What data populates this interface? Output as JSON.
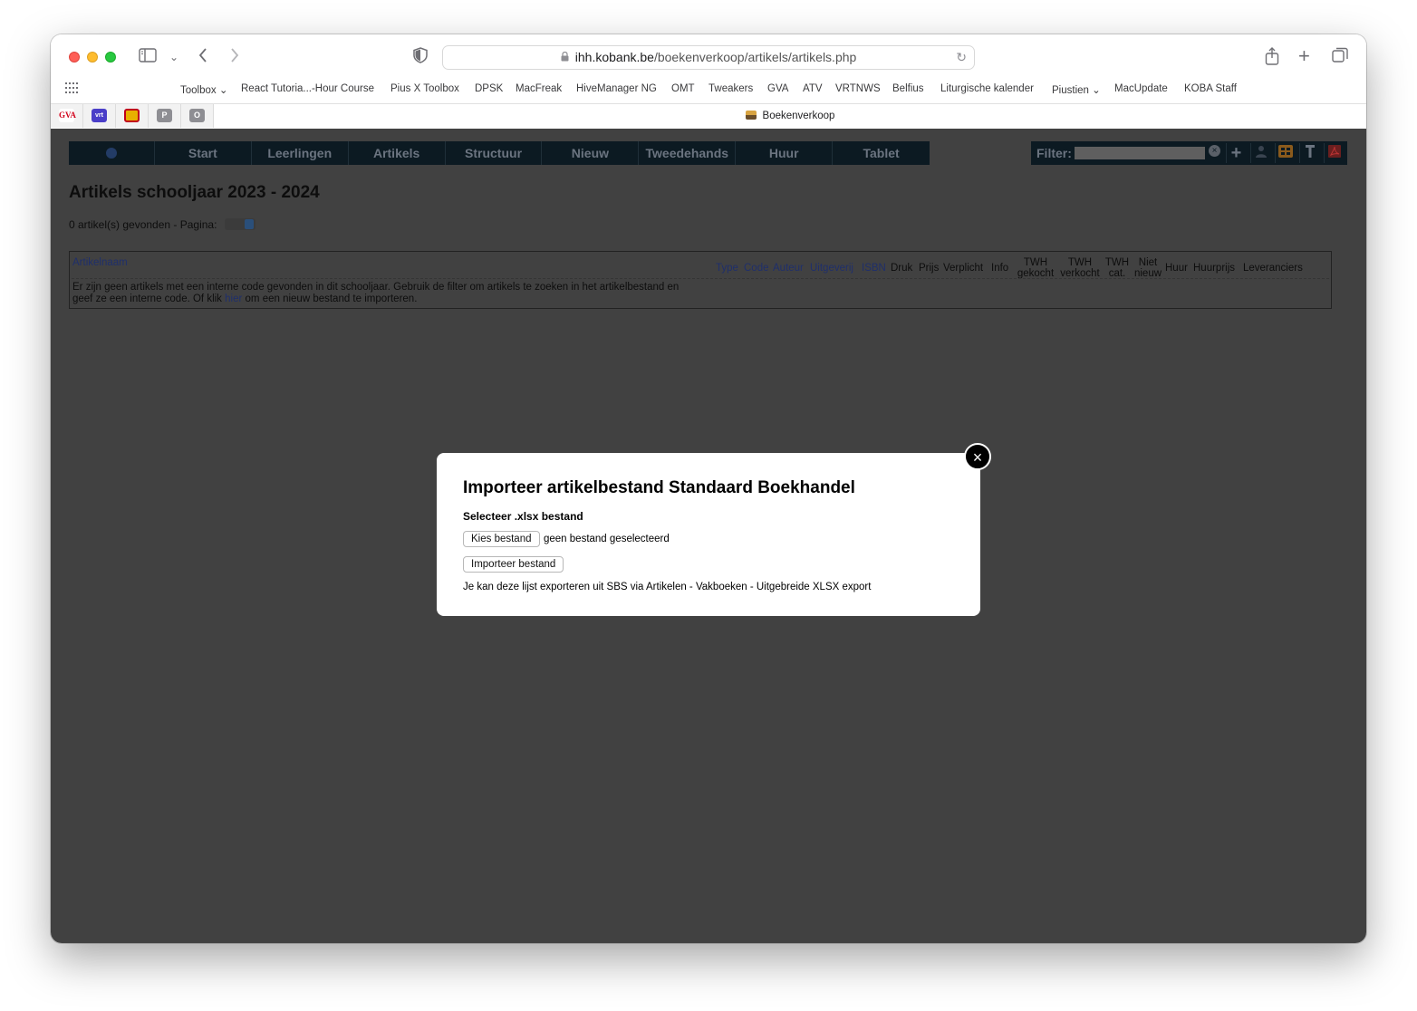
{
  "browser": {
    "url_host": "ihh.kobank.be",
    "url_path": "/boekenverkoop/artikels/artikels.php",
    "tab_title": "Boekenverkoop",
    "bookmarks": [
      "Toolbox ⌄",
      "React Tutoria...-Hour Course",
      "Pius X Toolbox",
      "DPSK",
      "MacFreak",
      "HiveManager NG",
      "OMT",
      "Tweakers",
      "GVA",
      "ATV",
      "VRTNWS",
      "Belfius",
      "Liturgische kalender",
      "Piustien ⌄",
      "MacUpdate",
      "KOBA Staff"
    ],
    "pinned_tabs": [
      "GVA",
      "vrt",
      "",
      "P",
      "O"
    ]
  },
  "nav": {
    "items": [
      "Start",
      "Leerlingen",
      "Artikels",
      "Structuur",
      "Nieuw",
      "Tweedehands",
      "Huur",
      "Tablet"
    ],
    "filter_label": "Filter:",
    "filter_value": ""
  },
  "page": {
    "title": "Artikels schooljaar 2023 - 2024",
    "count_text": "0 artikel(s) gevonden - Pagina:"
  },
  "table": {
    "headers": {
      "artikelnaam": "Artikelnaam",
      "type": "Type",
      "code": "Code",
      "auteur": "Auteur",
      "uitgeverij": "Uitgeverij",
      "isbn": "ISBN",
      "druk": "Druk",
      "prijs": "Prijs",
      "verplicht": "Verplicht",
      "info": "Info",
      "twh_gekocht_1": "TWH",
      "twh_gekocht_2": "gekocht",
      "twh_verkocht_1": "TWH",
      "twh_verkocht_2": "verkocht",
      "twh_cat_1": "TWH",
      "twh_cat_2": "cat.",
      "niet_nieuw_1": "Niet",
      "niet_nieuw_2": "nieuw",
      "huur": "Huur",
      "huurprijs": "Huurprijs",
      "leveranciers": "Leveranciers"
    },
    "empty_message_before": "Er zijn geen artikels met een interne code gevonden in dit schooljaar. Gebruik de filter om artikels te zoeken in het artikelbestand en geef ze een interne code. Of klik ",
    "empty_message_link": "hier",
    "empty_message_after": " om een nieuw bestand te importeren."
  },
  "modal": {
    "title": "Importeer artikelbestand Standaard Boekhandel",
    "subtitle": "Selecteer .xlsx bestand",
    "choose_button": "Kies bestand",
    "file_status": "geen bestand geselecteerd",
    "import_button": "Importeer bestand",
    "note": "Je kan deze lijst exporteren uit SBS via Artikelen - Vakboeken - Uitgebreide XLSX export",
    "close_glyph": "×"
  }
}
